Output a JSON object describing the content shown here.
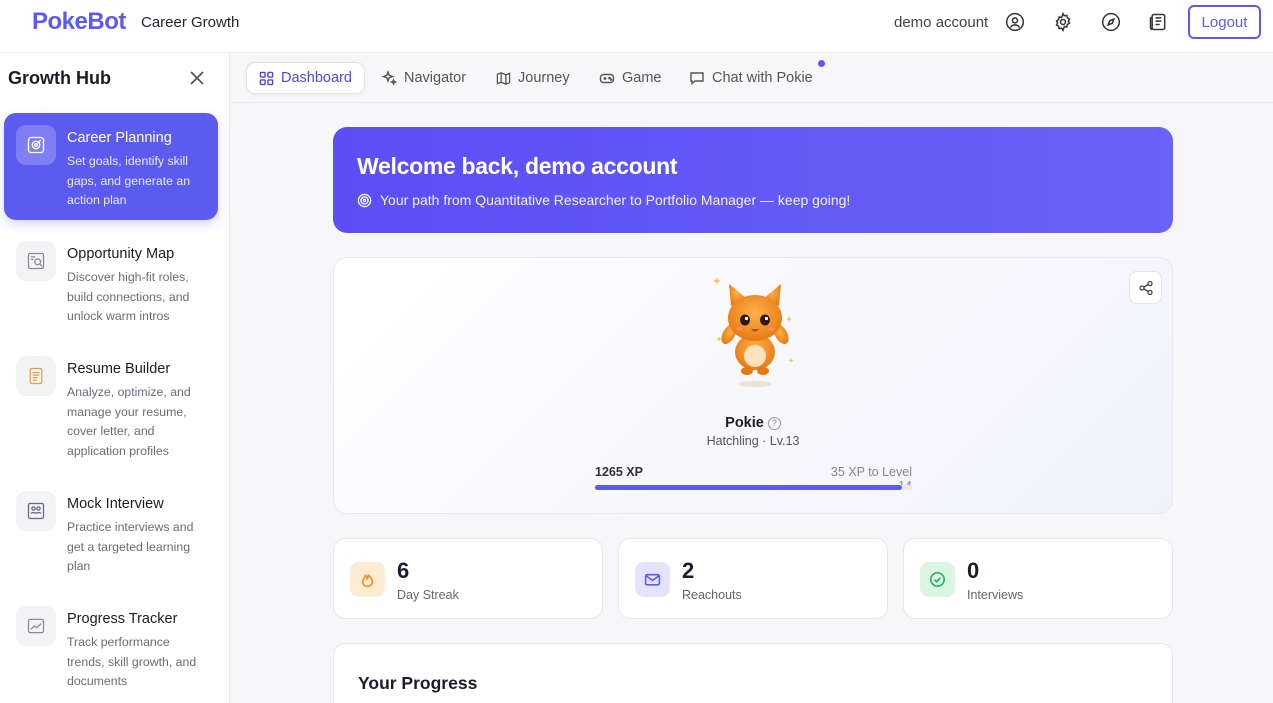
{
  "header": {
    "brand": "PokeBot",
    "section": "Career Growth",
    "account": "demo account",
    "logout_label": "Logout",
    "icons": [
      "user-circle-icon",
      "gear-icon",
      "compass-icon",
      "newspaper-icon"
    ]
  },
  "sidebar": {
    "title": "Growth Hub",
    "items": [
      {
        "title": "Career Planning",
        "desc": "Set goals, identify skill gaps, and generate an action plan",
        "active": true
      },
      {
        "title": "Opportunity Map",
        "desc": "Discover high-fit roles, build connections, and unlock warm intros"
      },
      {
        "title": "Resume Builder",
        "desc": "Analyze, optimize, and manage your resume, cover letter, and application profiles"
      },
      {
        "title": "Mock Interview",
        "desc": "Practice interviews and get a targeted learning plan"
      },
      {
        "title": "Progress Tracker",
        "desc": "Track performance trends, skill growth, and documents"
      }
    ]
  },
  "tabs": [
    {
      "label": "Dashboard",
      "active": true
    },
    {
      "label": "Navigator"
    },
    {
      "label": "Journey"
    },
    {
      "label": "Game"
    },
    {
      "label": "Chat with Pokie"
    }
  ],
  "welcome": {
    "title": "Welcome back, demo account",
    "subtitle": "Your path from Quantitative Researcher to Portfolio Manager — keep going!"
  },
  "pet": {
    "name": "Pokie",
    "stage": "Hatchling · Lv.13",
    "xp_label": "1265 XP",
    "xp_next": "35 XP to Level 14",
    "xp_progress": 0.97
  },
  "stats": [
    {
      "value": "6",
      "label": "Day Streak",
      "icon": "flame-icon",
      "color": "#f59e0b"
    },
    {
      "value": "2",
      "label": "Reachouts",
      "icon": "mail-icon",
      "color": "#5b5bf0"
    },
    {
      "value": "0",
      "label": "Interviews",
      "icon": "check-circle-icon",
      "color": "#22c55e"
    }
  ],
  "progress": {
    "title": "Your Progress"
  },
  "colors": {
    "accent": "#5b5bf0",
    "banner": "#5b4ef5"
  }
}
